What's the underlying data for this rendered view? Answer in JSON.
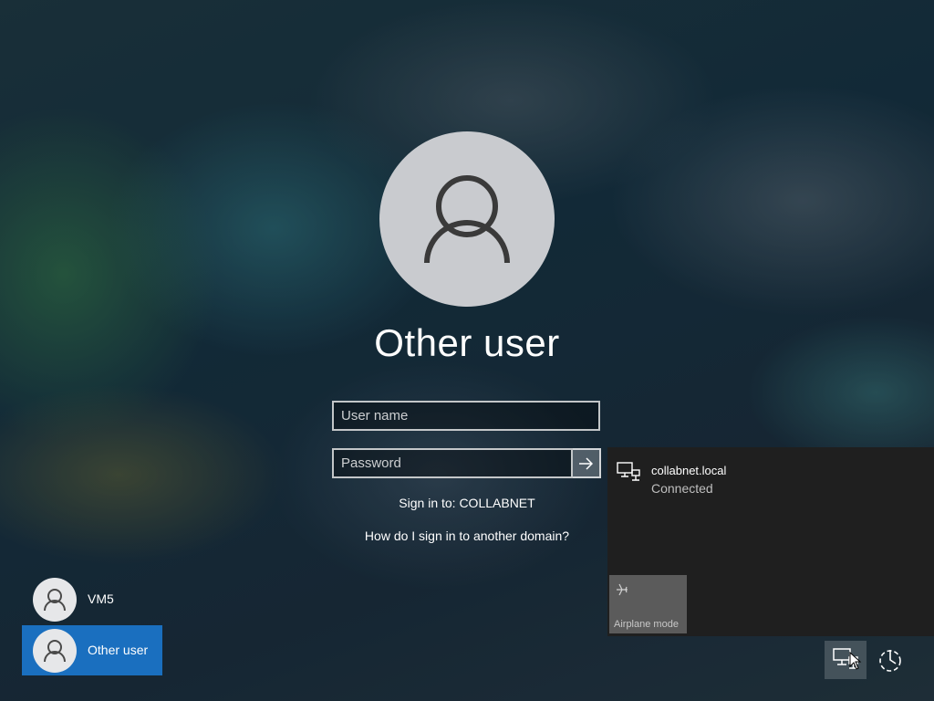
{
  "login": {
    "title": "Other user",
    "username_placeholder": "User name",
    "password_placeholder": "Password",
    "sign_in_to": "Sign in to: COLLABNET",
    "domain_help_link": "How do I sign in to another domain?"
  },
  "users": [
    {
      "name": "VM5",
      "selected": false
    },
    {
      "name": "Other user",
      "selected": true
    }
  ],
  "network_flyout": {
    "network_name": "collabnet.local",
    "network_status": "Connected",
    "airplane_label": "Airplane mode"
  },
  "icons": {
    "avatar": "person-icon",
    "submit": "arrow-right-icon",
    "network": "wired-network-icon",
    "airplane": "airplane-icon",
    "ease_of_access": "power-icon"
  },
  "colors": {
    "selected_user_bg": "#1a6fbf",
    "flyout_bg": "#1f1f1f",
    "airplane_tile_bg": "#5b5b5b"
  }
}
